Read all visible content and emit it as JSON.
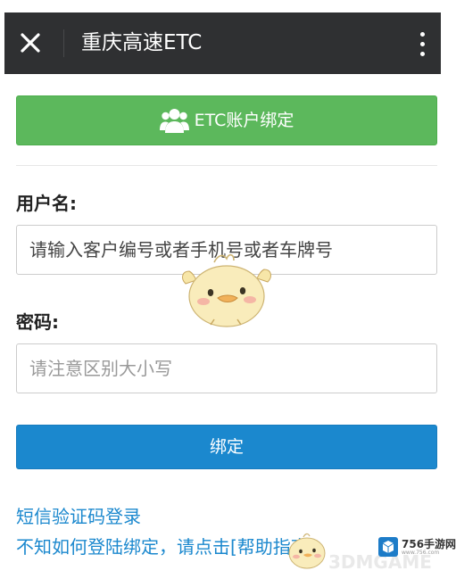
{
  "header": {
    "title": "重庆高速ETC",
    "close_icon": "close-icon",
    "more_icon": "more-vertical-icon"
  },
  "bind_account_button": {
    "label": "ETC账户绑定",
    "icon": "user-group-icon"
  },
  "form": {
    "username": {
      "label": "用户名:",
      "placeholder": "请输入客户编号或者手机号或者车牌号",
      "value": ""
    },
    "password": {
      "label": "密码:",
      "placeholder": "请注意区别大小写",
      "value": ""
    },
    "submit_label": "绑定"
  },
  "links": {
    "sms_login": "短信验证码登录",
    "help_prefix": "不知如何登陆绑定，请点击",
    "help_link": "[帮助指南]"
  },
  "watermarks": {
    "left_text": "3DMGAME",
    "brand": "756手游网",
    "url": "www.756.com"
  },
  "colors": {
    "header_bg": "#2f3032",
    "bind_account_green": "#5cb85c",
    "submit_blue": "#1b88ce",
    "link_blue": "#1b88ce"
  }
}
